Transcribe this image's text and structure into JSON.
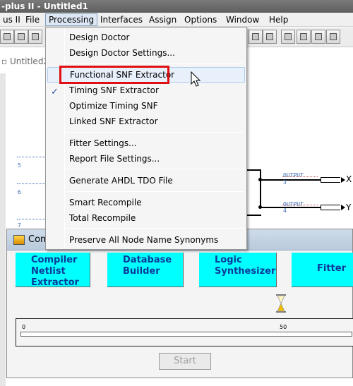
{
  "window": {
    "title": "-plus II - Untitled1"
  },
  "menubar": {
    "items": [
      {
        "label": "us II"
      },
      {
        "label": "File"
      },
      {
        "label": "Processing"
      },
      {
        "label": "Interfaces"
      },
      {
        "label": "Assign"
      },
      {
        "label": "Options"
      },
      {
        "label": "Window"
      },
      {
        "label": "Help"
      }
    ],
    "active": "Processing"
  },
  "document": {
    "tab_title": "Untitled2"
  },
  "processing_menu": {
    "items": [
      {
        "label": "Design Doctor"
      },
      {
        "label": "Design Doctor Settings..."
      },
      {
        "label": "Functional SNF Extractor"
      },
      {
        "label": "Timing SNF Extractor",
        "checked": true
      },
      {
        "label": "Optimize Timing SNF"
      },
      {
        "label": "Linked SNF Extractor"
      },
      {
        "label": "Fitter Settings..."
      },
      {
        "label": "Report File Settings..."
      },
      {
        "label": "Generate AHDL TDO File"
      },
      {
        "label": "Smart Recompile"
      },
      {
        "label": "Total Recompile"
      },
      {
        "label": "Preserve All Node Name Synonyms"
      }
    ],
    "hovered": "Functional SNF Extractor",
    "highlighted": "Functional SNF Extractor",
    "check_mark": "✓"
  },
  "schematic": {
    "pin_numbers": [
      "5",
      "6",
      "7",
      "3",
      "4"
    ],
    "outputs": [
      {
        "tag": "OUTPUT",
        "name": "X"
      },
      {
        "tag": "OUTPUT",
        "name": "Y"
      }
    ]
  },
  "compiler": {
    "title": "Com",
    "modules": [
      {
        "label": "Compiler Netlist Extractor"
      },
      {
        "label": "Database Builder"
      },
      {
        "label": "Logic Synthesizer"
      },
      {
        "label": "Fitter"
      }
    ],
    "progress": {
      "percent": 0,
      "tick_labels": [
        "0",
        "50"
      ]
    },
    "start_label": "Start"
  },
  "colors": {
    "module_bg": "#00ffff",
    "module_text": "#0a3a9a",
    "highlight_box": "#e01010",
    "pin_label": "#3a6ab4"
  }
}
